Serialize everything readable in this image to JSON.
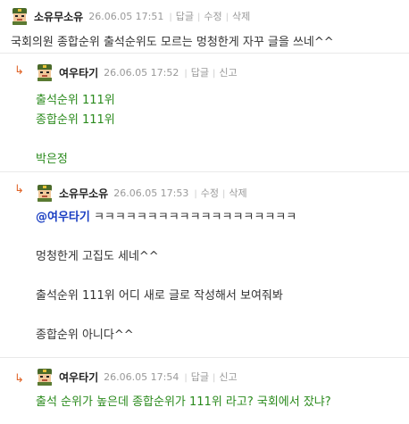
{
  "comments": [
    {
      "nick": "소유무소유",
      "date": "26.06.05 17:51",
      "actions": [
        "답글",
        "수정",
        "삭제"
      ],
      "lines": [
        "국회의원 종합순위 출석순위도 모르는 멍청한게 자꾸 글을 쓰네^^"
      ]
    },
    {
      "nick": "여우타기",
      "date": "26.06.05 17:52",
      "actions": [
        "답글",
        "신고"
      ],
      "lines": [
        "출석순위 111위",
        "종합순위 111위",
        "박은정"
      ]
    },
    {
      "nick": "소유무소유",
      "date": "26.06.05 17:53",
      "actions": [
        "수정",
        "삭제"
      ],
      "mention": "@여우타기",
      "mention_rest": " ㅋㅋㅋㅋㅋㅋㅋㅋㅋㅋㅋㅋㅋㅋㅋㅋㅋㅋㅋ",
      "lines": [
        "멍청한게 고집도 세네^^",
        "출석순위 111위 어디 새로 글로 작성해서 보여줘봐",
        "종합순위 아니다^^"
      ]
    },
    {
      "nick": "여우타기",
      "date": "26.06.05 17:54",
      "actions": [
        "답글",
        "신고"
      ],
      "lines": [
        "출석 순위가 높은데 종합순위가 111위 라고? 국회에서 잤냐?"
      ]
    }
  ],
  "colors": {
    "green_text": "#2a8a1c",
    "mention": "#1a3ec2",
    "reply_arrow": "#e0662a"
  },
  "icons": {
    "reply_arrow": "reply-arrow-icon",
    "avatar": "soldier-avatar-icon"
  }
}
